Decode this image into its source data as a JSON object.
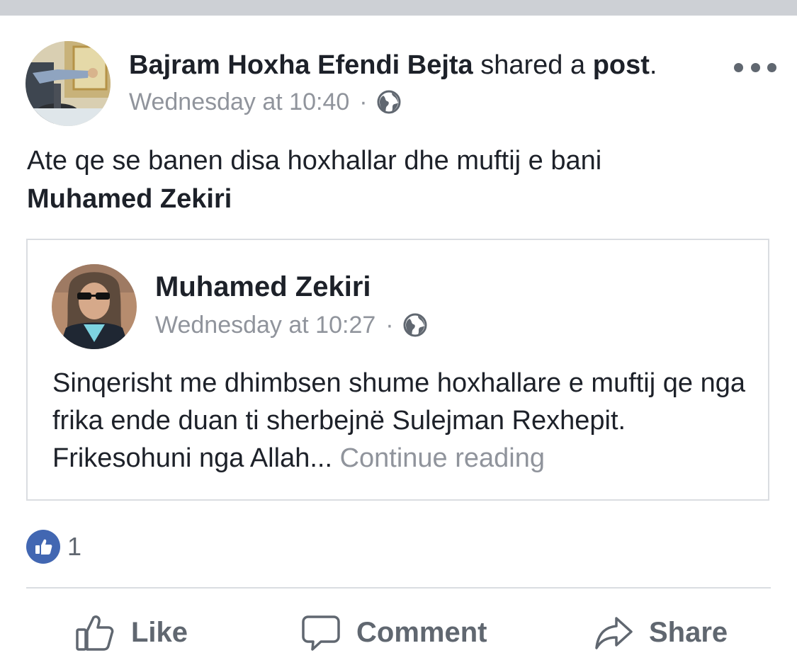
{
  "post": {
    "author": "Bajram Hoxha Efendi Bejta",
    "action_text": "shared a",
    "action_link": "post",
    "action_period": ".",
    "timestamp": "Wednesday at 10:40",
    "separator": "·",
    "privacy_icon": "globe-icon",
    "more_icon": "more-options-icon",
    "body_text": "Ate qe se banen disa hoxhallar dhe muftij e bani",
    "body_mention": "Muhamed Zekiri"
  },
  "shared_post": {
    "author": "Muhamed Zekiri",
    "timestamp": "Wednesday at 10:27",
    "separator": "·",
    "privacy_icon": "globe-icon",
    "text": "Sinqerisht me dhimbsen shume hoxhallare e muftij qe nga frika ende duan ti sherbejnë Sulejman Rexhepit. Frikesohuni nga Allah...",
    "continue_label": "Continue reading"
  },
  "reactions": {
    "icon": "like-reaction-icon",
    "count": "1"
  },
  "actions": {
    "like_label": "Like",
    "comment_label": "Comment",
    "share_label": "Share"
  },
  "colors": {
    "like_blue": "#4267b2",
    "muted_text": "#90949c",
    "action_text": "#606770",
    "divider": "#dadde1"
  }
}
